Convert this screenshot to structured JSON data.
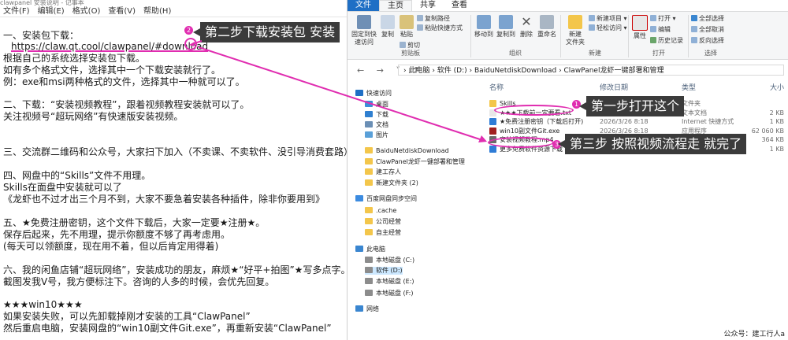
{
  "notepad": {
    "title": "clawpanel 安装说明 - 记事本",
    "menu": [
      "文件(F)",
      "编辑(E)",
      "格式(O)",
      "查看(V)",
      "帮助(H)"
    ],
    "lines": [
      "一、安装包下载：",
      "https://claw.qt.cool/clawpanel/#download",
      "   根据自己的系统选择安装包下载。",
      "     如有多个格式文件，选择其中一个下载安装就行了。",
      "     例：exe和msi两种格式的文件，选择其中一种就可以了。",
      "二、下载：“安装视频教程”，跟着视频教程安装就可以了。",
      "     关注视频号“超玩网络”有快速版安装视频。",
      "三、交流群二维码和公众号，大家扫下加入（不卖课、不卖软件、没引导消费套路）。",
      "四、网盘中的“Skills”文件不用理。",
      "     Skills在面盘中安装就可以了",
      "   《龙虾也不过才出三个月不到，大家不要急着安装各种插件，除非你要用到》",
      "五、★免费注册密钥，这个文件下载后，大家一定要★注册★。",
      "     保存后起来，先不用理，提示你额度不够了再考虑用。",
      "     (每天可以领额度，现在用不着，但以后肯定用得着)",
      "六、我的闲鱼店铺“超玩网络”，安装成功的朋友，麻烦★“好平+拍图”★写多点字。",
      "     截图发我V号，我方便标注下。咨询的人多的时候，会优先回复。",
      "★★★win10★★★",
      "如果安装失败，可以先卸载掉刚才安装的工具“ClawPanel”",
      "然后重启电脑，安装网盘的“win10副文件Git.exe”，再重新安装“ClawPanel”"
    ]
  },
  "explorer": {
    "tabs": [
      "文件",
      "主页",
      "共享",
      "查看"
    ],
    "ribbon": {
      "clipboard": {
        "pin": "固定到快\n速访问",
        "copy": "复制",
        "paste": "粘贴",
        "copy_path": "复制路径",
        "paste_shortcut": "粘贴快捷方式",
        "cut": "剪切",
        "label": "剪贴板"
      },
      "organize": {
        "move_to": "移动到",
        "copy_to": "复制到",
        "delete": "删除",
        "rename": "重命名",
        "label": "组织"
      },
      "new": {
        "new_folder": "新建\n文件夹",
        "new_item": "新建项目 ▾",
        "easy_access": "轻松访问 ▾",
        "label": "新建"
      },
      "open": {
        "properties": "属性",
        "open": "打开 ▾",
        "edit": "编辑",
        "history": "历史记录",
        "label": "打开"
      },
      "select": {
        "select_all": "全部选择",
        "select_none": "全部取消",
        "invert": "反向选择",
        "label": "选择"
      }
    },
    "address": {
      "nav": "← → ˅ ↑",
      "path": "›  此电脑  ›  软件 (D:)  ›  BaiduNetdiskDownload  ›  ClawPanel龙虾一键部署和管理"
    },
    "nav_pane": [
      {
        "label": "快速访问",
        "icon": "star-icon",
        "color": "#1f6fc5",
        "indent": 0
      },
      {
        "label": "桌面",
        "icon": "desktop-icon",
        "color": "#3b8ed8",
        "indent": 1
      },
      {
        "label": "下载",
        "icon": "download-icon",
        "color": "#2f7fd0",
        "indent": 1
      },
      {
        "label": "文档",
        "icon": "document-icon",
        "color": "#6b8fb5",
        "indent": 1
      },
      {
        "label": "图片",
        "icon": "picture-icon",
        "color": "#5aa0d8",
        "indent": 1
      },
      {
        "label": "BaiduNetdiskDownload",
        "icon": "folder-icon",
        "color": "#f3c64b",
        "indent": 1
      },
      {
        "label": "ClawPanel龙虾一键部署和管理",
        "icon": "folder-icon",
        "color": "#f3c64b",
        "indent": 1
      },
      {
        "label": "建工存人",
        "icon": "folder-icon",
        "color": "#f3c64b",
        "indent": 1
      },
      {
        "label": "新建文件夹 (2)",
        "icon": "folder-icon",
        "color": "#f3c64b",
        "indent": 1
      },
      {
        "label": "百度网盘同步空间",
        "icon": "cloud-icon",
        "color": "#3c8be0",
        "indent": 0
      },
      {
        "label": ".cache",
        "icon": "folder-icon",
        "color": "#f3c64b",
        "indent": 1
      },
      {
        "label": "公司经营",
        "icon": "folder-icon",
        "color": "#f3c64b",
        "indent": 1
      },
      {
        "label": "自主经营",
        "icon": "folder-icon",
        "color": "#f3c64b",
        "indent": 1
      },
      {
        "label": "此电脑",
        "icon": "computer-icon",
        "color": "#3a86d0",
        "indent": 0
      },
      {
        "label": "本地磁盘 (C:)",
        "icon": "drive-icon",
        "color": "#8c8c8c",
        "indent": 1
      },
      {
        "label": "软件 (D:)",
        "icon": "drive-icon",
        "color": "#8c8c8c",
        "indent": 1,
        "selected": true
      },
      {
        "label": "本地磁盘 (E:)",
        "icon": "drive-icon",
        "color": "#8c8c8c",
        "indent": 1
      },
      {
        "label": "本地磁盘 (F:)",
        "icon": "drive-icon",
        "color": "#8c8c8c",
        "indent": 1
      },
      {
        "label": "网络",
        "icon": "network-icon",
        "color": "#3a86d0",
        "indent": 0
      }
    ],
    "columns": {
      "name": "名称",
      "date": "修改日期",
      "type": "类型",
      "size": "大小"
    },
    "files": [
      {
        "name": "Skills",
        "date": "",
        "type": "文件夹",
        "size": "",
        "icon": "folder-icon",
        "color": "#f3c64b"
      },
      {
        "name": "★★★下载前一定要看.txt",
        "date": "",
        "type": "文本文档",
        "size": "2 KB",
        "icon": "text-file-icon",
        "color": "#e8e8e8"
      },
      {
        "name": "★免费注册密钥（下载后打开)",
        "date": "2026/3/26 8:18",
        "type": "Internet 快捷方式",
        "size": "1 KB",
        "icon": "link-icon",
        "color": "#2e7cd6"
      },
      {
        "name": "win10副文件Git.exe",
        "date": "2026/3/26 8:18",
        "type": "应用程序",
        "size": "62 060 KB",
        "icon": "exe-icon",
        "color": "#a02020"
      },
      {
        "name": "安装视频教程.mp4",
        "date": "",
        "type": "",
        "size": "364 KB",
        "icon": "video-icon",
        "color": "#6a6a6a"
      },
      {
        "name": "更多免费软件资源下载 w",
        "date": "",
        "type": "",
        "size": "1 KB",
        "icon": "link-icon",
        "color": "#2e7cd6"
      }
    ],
    "footer": "公众号：建工行人a"
  },
  "callouts": {
    "step1": {
      "badge": "1",
      "text": "第一步打开这个"
    },
    "step2": {
      "badge": "2",
      "text": "第二步下载安装包 安装"
    },
    "step3": {
      "badge": "3",
      "text": "第三步 按照视频流程走 就完了"
    }
  }
}
